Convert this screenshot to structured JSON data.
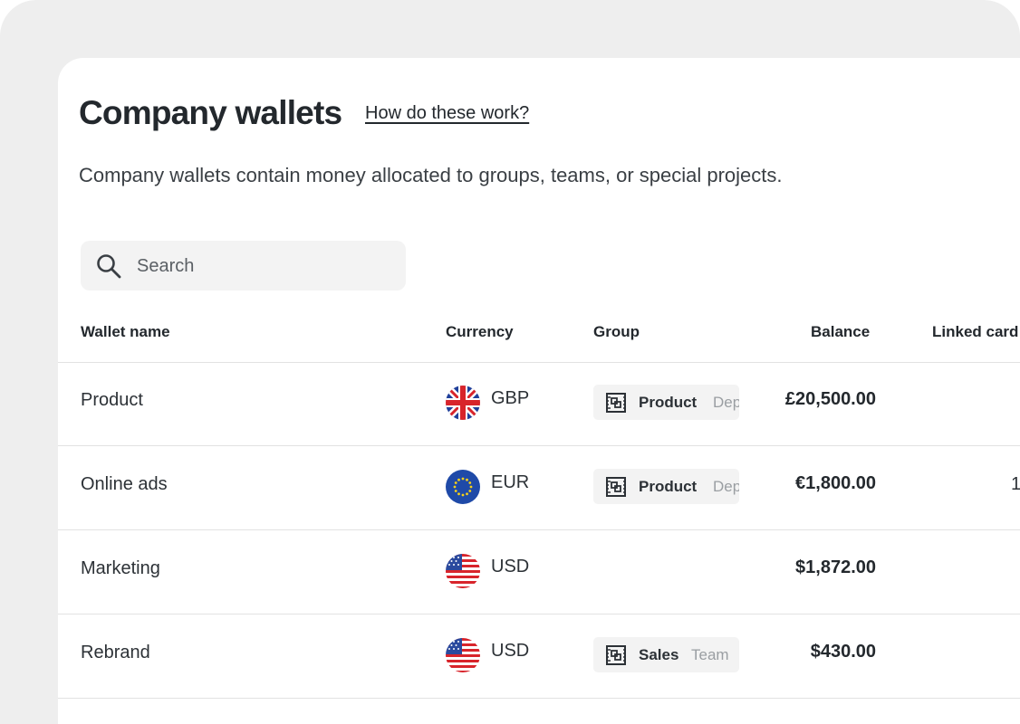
{
  "page": {
    "title": "Company wallets",
    "help_link": "How do these work?",
    "subtitle": "Company wallets contain money allocated to groups, teams, or special projects."
  },
  "search": {
    "placeholder": "Search",
    "value": ""
  },
  "table": {
    "headers": {
      "wallet_name": "Wallet name",
      "currency": "Currency",
      "group": "Group",
      "balance": "Balance",
      "linked_cards": "Linked card"
    },
    "rows": [
      {
        "name": "Product",
        "currency": "GBP",
        "flag": "uk-flag-icon",
        "group_name": "Product",
        "group_type": "Dep",
        "balance": "£20,500.00",
        "linked_cards": ""
      },
      {
        "name": "Online ads",
        "currency": "EUR",
        "flag": "eu-flag-icon",
        "group_name": "Product",
        "group_type": "Dep",
        "balance": "€1,800.00",
        "linked_cards": "1"
      },
      {
        "name": "Marketing",
        "currency": "USD",
        "flag": "us-flag-icon",
        "group_name": "",
        "group_type": "",
        "balance": "$1,872.00",
        "linked_cards": ""
      },
      {
        "name": "Rebrand",
        "currency": "USD",
        "flag": "us-flag-icon",
        "group_name": "Sales",
        "group_type": "Team",
        "balance": "$430.00",
        "linked_cards": ""
      }
    ]
  },
  "colors": {
    "text": "#23282d",
    "muted": "#9a9ea2",
    "pill_bg": "#f3f3f3",
    "outer_bg": "#eeeeee",
    "divider": "#e2e2e2"
  }
}
